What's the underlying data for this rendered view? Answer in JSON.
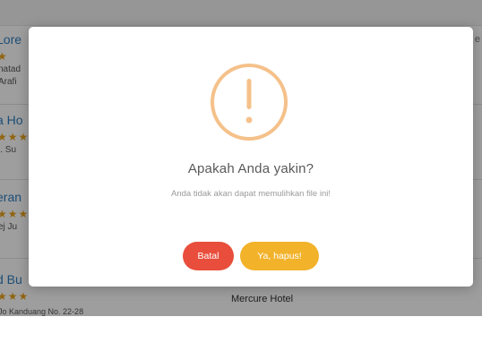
{
  "background": {
    "corner_text": "e",
    "items": [
      {
        "title": "Lore",
        "stars": "★",
        "addr": "natad",
        "addr2": "Arafi"
      },
      {
        "title": "a Ho",
        "stars": "★★★",
        "addr": "l. Su",
        "addr2": ""
      },
      {
        "title": "eran",
        "stars": "★★★",
        "addr": "ej Ju",
        "addr2": ""
      },
      {
        "title": "d Bu",
        "stars": "★★★",
        "addr": "",
        "addr2": ""
      }
    ],
    "hotel_name": "Mercure Hotel",
    "hotel_addr": "Jo Kanduang No. 22-28"
  },
  "modal": {
    "icon": "exclamation-circle-icon",
    "icon_color": "#f5c18a",
    "title": "Apakah Anda yakin?",
    "text": "Anda tidak akan dapat memulihkan file ini!",
    "cancel_label": "Batal",
    "cancel_color": "#e84e3b",
    "confirm_label": "Ya, hapus!",
    "confirm_color": "#f2b22a"
  }
}
